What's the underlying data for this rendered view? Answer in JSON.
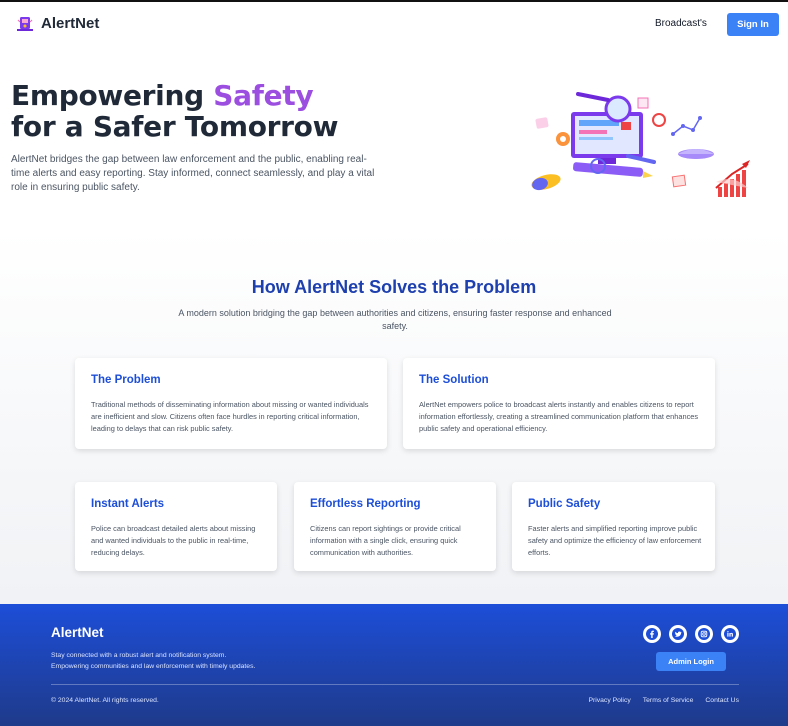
{
  "header": {
    "brand": "AlertNet",
    "nav_broadcasts": "Broadcast's",
    "signin_label": "Sign In"
  },
  "hero": {
    "title_part1": "Empowering ",
    "title_accent": "Safety",
    "title_line2": "for a Safer Tomorrow",
    "description": "AlertNet bridges the gap between law enforcement and the public, enabling real-time alerts and easy reporting. Stay informed, connect seamlessly, and play a vital role in ensuring public safety.",
    "illustration_icon": "analytics-illustration"
  },
  "solution_section": {
    "title": "How AlertNet Solves the Problem",
    "subtitle": "A modern solution bridging the gap between authorities and citizens, ensuring faster response and enhanced safety.",
    "cards": [
      {
        "title": "The Problem",
        "text": "Traditional methods of disseminating information about missing or wanted individuals are inefficient and slow. Citizens often face hurdles in reporting critical information, leading to delays that can risk public safety."
      },
      {
        "title": "The Solution",
        "text": "AlertNet empowers police to broadcast alerts instantly and enables citizens to report information effortlessly, creating a streamlined communication platform that enhances public safety and operational efficiency."
      },
      {
        "title": "Instant Alerts",
        "text": "Police can broadcast detailed alerts about missing and wanted individuals to the public in real-time, reducing delays."
      },
      {
        "title": "Effortless Reporting",
        "text": "Citizens can report sightings or provide critical information with a single click, ensuring quick communication with authorities."
      },
      {
        "title": "Public Safety",
        "text": "Faster alerts and simplified reporting improve public safety and optimize the efficiency of law enforcement efforts."
      }
    ]
  },
  "footer": {
    "brand": "AlertNet",
    "desc_line1": "Stay connected with a robust alert and notification system.",
    "desc_line2": "Empowering communities and law enforcement with timely updates.",
    "social_icons": [
      "facebook-icon",
      "twitter-icon",
      "instagram-icon",
      "linkedin-icon"
    ],
    "admin_label": "Admin Login",
    "copyright": "© 2024 AlertNet. All rights reserved.",
    "links": [
      "Privacy Policy",
      "Terms of Service",
      "Contact Us"
    ]
  },
  "colors": {
    "accent_purple": "#9b4ee0",
    "primary_blue": "#3b82f6",
    "heading_blue": "#1e40af",
    "footer_blue": "#1d4ed8"
  }
}
